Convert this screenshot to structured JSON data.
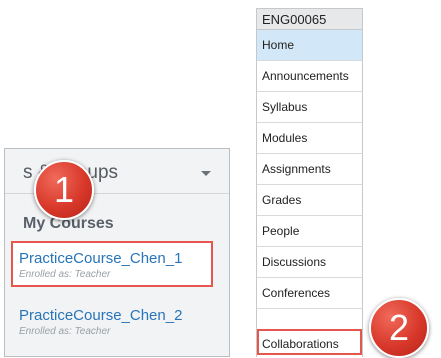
{
  "left_panel": {
    "title": "s & Groups",
    "courses_heading": "My Courses",
    "courses": [
      {
        "name": "PracticeCourse_Chen_1",
        "role": "Enrolled as: Teacher"
      },
      {
        "name": "PracticeCourse_Chen_2",
        "role": "Enrolled as: Teacher"
      }
    ]
  },
  "right_panel": {
    "course_code": "ENG00065",
    "items": [
      {
        "label": "Home"
      },
      {
        "label": "Announcements"
      },
      {
        "label": "Syllabus"
      },
      {
        "label": "Modules"
      },
      {
        "label": "Assignments"
      },
      {
        "label": "Grades"
      },
      {
        "label": "People"
      },
      {
        "label": "Discussions"
      },
      {
        "label": "Conferences"
      },
      {
        "label": "Collaborations"
      }
    ]
  },
  "badges": {
    "first": "1",
    "second": "2"
  },
  "colors": {
    "link": "#2775b8",
    "highlight_border": "#e7564c",
    "badge": "#d8382a",
    "active_nav": "#d2e7f7"
  }
}
